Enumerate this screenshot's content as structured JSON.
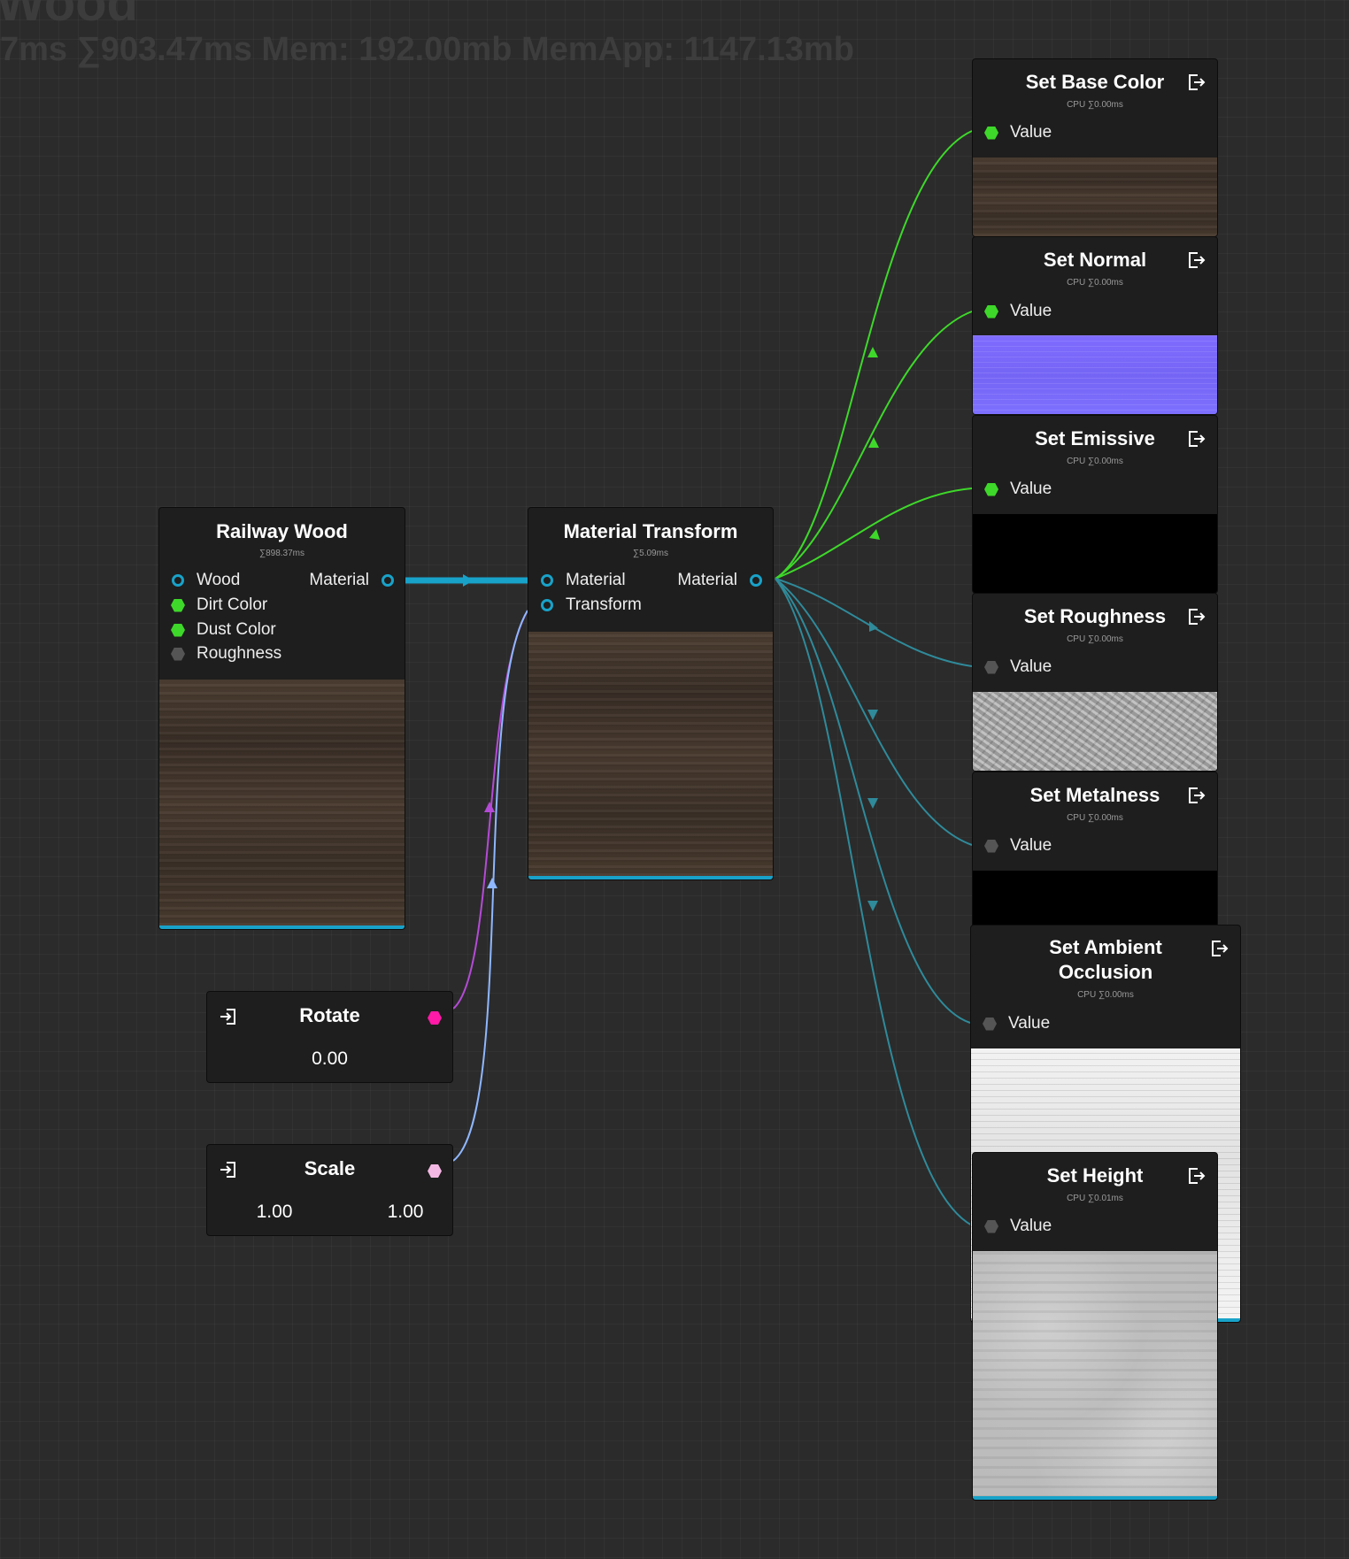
{
  "hud": {
    "title": "Wood",
    "stats": "7ms ∑903.47ms Mem: 192.00mb MemApp: 1147.13mb"
  },
  "railway_wood": {
    "title": "Railway Wood",
    "timing": "∑898.37ms",
    "inputs": [
      "Wood",
      "Dirt Color",
      "Dust Color",
      "Roughness"
    ],
    "output": "Material"
  },
  "material_transform": {
    "title": "Material Transform",
    "timing": "∑5.09ms",
    "inputs": [
      "Material",
      "Transform"
    ],
    "output": "Material"
  },
  "rotate": {
    "title": "Rotate",
    "value": "0.00",
    "pin_color": "#ff1aa8"
  },
  "scale": {
    "title": "Scale",
    "value_x": "1.00",
    "value_y": "1.00",
    "pin_color": "#f4b8e4"
  },
  "outputs": [
    {
      "title": "Set Base Color",
      "cpu": "CPU ∑0.00ms",
      "pin": "Value"
    },
    {
      "title": "Set Normal",
      "cpu": "CPU ∑0.00ms",
      "pin": "Value"
    },
    {
      "title": "Set Emissive",
      "cpu": "CPU ∑0.00ms",
      "pin": "Value"
    },
    {
      "title": "Set Roughness",
      "cpu": "CPU ∑0.00ms",
      "pin": "Value"
    },
    {
      "title": "Set Metalness",
      "cpu": "CPU ∑0.00ms",
      "pin": "Value"
    },
    {
      "title_line1": "Set Ambient",
      "title_line2": "Occlusion",
      "cpu": "CPU ∑0.00ms",
      "pin": "Value"
    },
    {
      "title": "Set Height",
      "cpu": "CPU ∑0.01ms",
      "pin": "Value"
    }
  ],
  "icons": {
    "exit": "exit-arrow-icon",
    "enter": "enter-arrow-icon"
  },
  "colors": {
    "material_wire": "#18a2c9",
    "color_wire": "#3ed82a",
    "gray_wire": "#2f8a9a",
    "rotate_wire": "#b44bd6",
    "scale_wire": "#8fb7ff",
    "node_bg": "#1e1e1e",
    "canvas_bg": "#2b2b2b"
  }
}
